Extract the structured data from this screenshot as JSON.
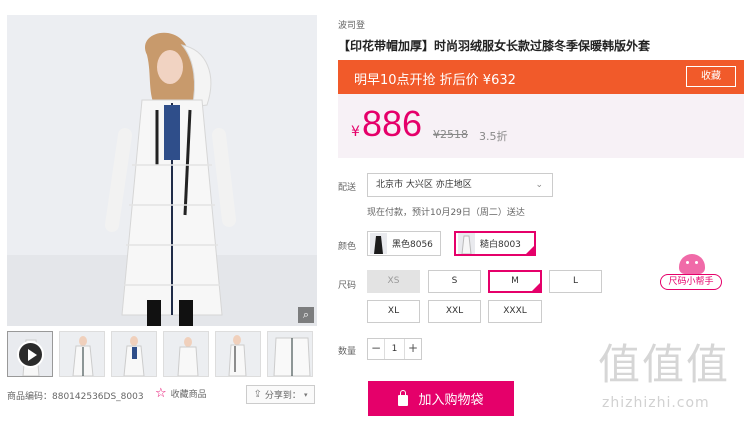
{
  "gallery": {
    "thumbnails": [
      "video",
      "white-coat-1",
      "white-coat-2",
      "white-coat-3",
      "white-coat-4",
      "white-coat-5"
    ],
    "product_code": "商品编码：880142536DS_8003",
    "favorite_label": "收藏商品",
    "share_label": "分享到：",
    "icons": {
      "zoom": "magnifier-icon",
      "play": "play-icon",
      "favorite": "star-icon",
      "share": "share-icon"
    }
  },
  "product": {
    "brand": "波司登",
    "title": "【印花带帽加厚】时尚羽绒服女长款过膝冬季保暖韩版外套"
  },
  "promo": {
    "text": "明早10点开抢 折后价 ¥632",
    "favorite_button": "收藏"
  },
  "price": {
    "currency": "¥",
    "current": "886",
    "original": "¥2518",
    "discount": "3.5折"
  },
  "shipping": {
    "label": "配送",
    "location": "北京市 大兴区 亦庄地区",
    "note": "现在付款，预计10月29日（周二）送达"
  },
  "color": {
    "label": "颜色",
    "options": [
      {
        "name": "黑色8056",
        "selected": false
      },
      {
        "name": "糙白8003",
        "selected": true
      }
    ]
  },
  "size": {
    "label": "尺码",
    "options": [
      "XS",
      "S",
      "M",
      "L",
      "XL",
      "XXL",
      "XXXL"
    ],
    "disabled": [
      "XS"
    ],
    "selected": "M",
    "helper": "尺码小帮手"
  },
  "quantity": {
    "label": "数量",
    "value": "1",
    "minus": "−",
    "plus": "+"
  },
  "cart_button": "加入购物袋",
  "watermark": {
    "glyphs": "值值值",
    "url": "zhizhizhi.com"
  },
  "colors": {
    "accent": "#e5006a",
    "promo_bg": "#f15a2a",
    "price_bg": "#f7f1f6"
  }
}
